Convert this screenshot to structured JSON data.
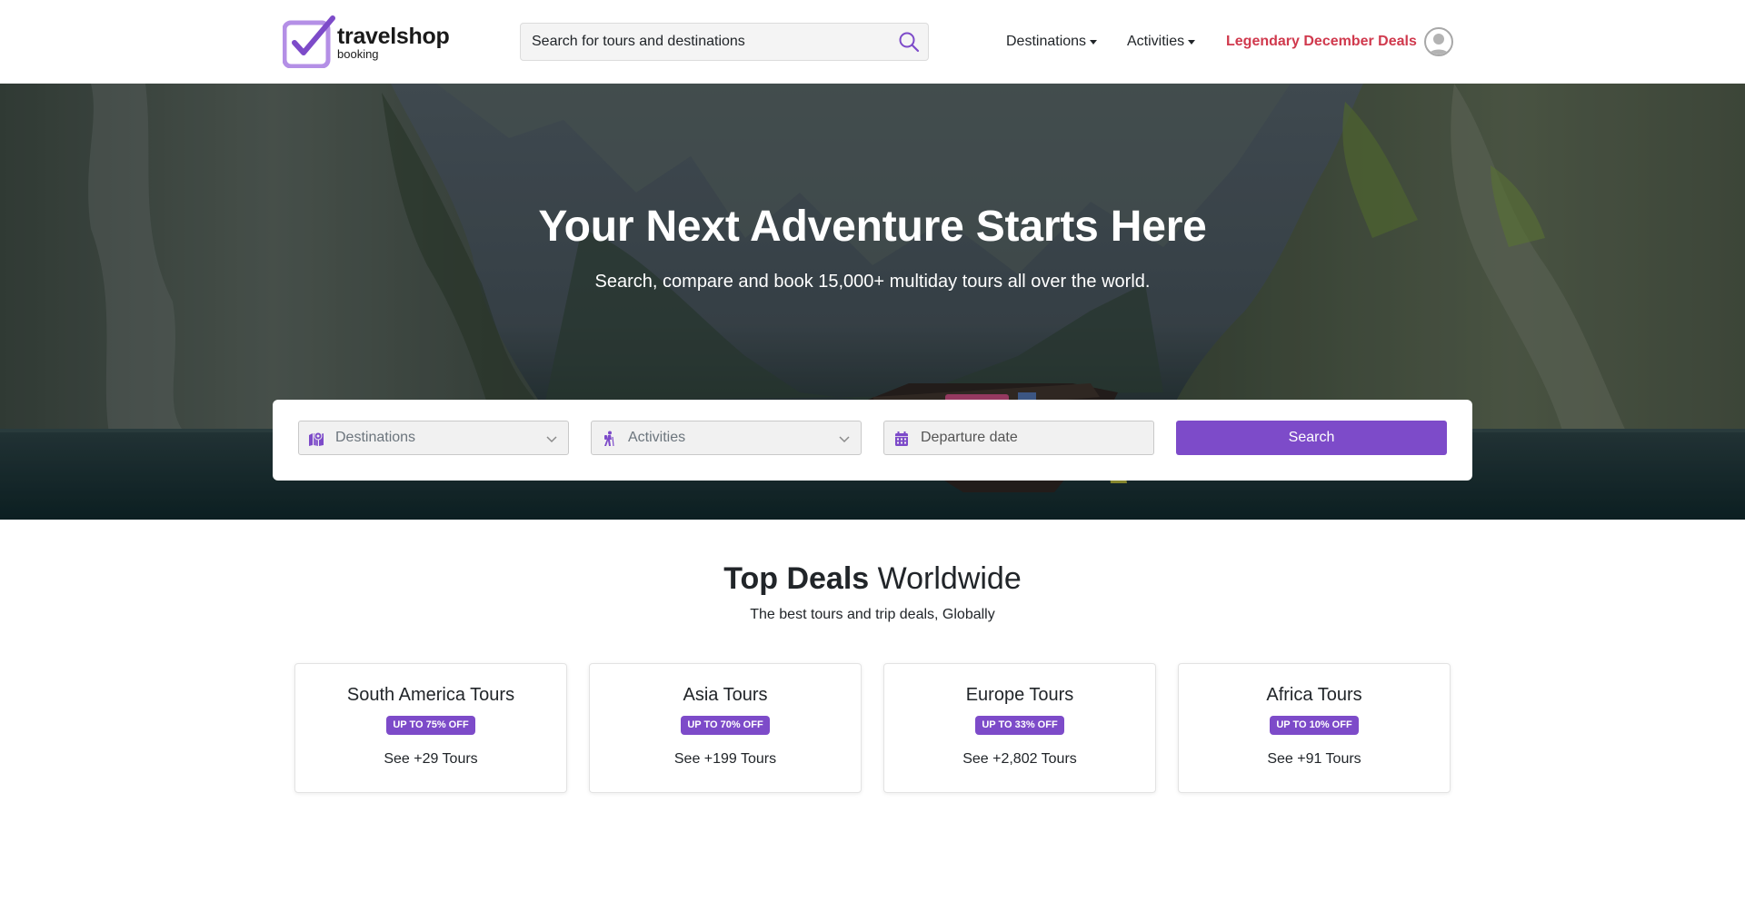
{
  "brand": {
    "name": "travelshop",
    "sub": "booking",
    "accent": "#7d4bc9",
    "accent_light": "#b48fe6"
  },
  "header": {
    "search_placeholder": "Search for tours and destinations",
    "nav": {
      "destinations": "Destinations",
      "activities": "Activities",
      "deals": "Legendary December Deals"
    },
    "deals_color": "#d0394d"
  },
  "hero": {
    "title": "Your Next Adventure Starts Here",
    "subtitle": "Search, compare and book 15,000+ multiday tours all over the world.",
    "search": {
      "destinations_label": "Destinations",
      "activities_label": "Activities",
      "date_placeholder": "Departure date",
      "button_label": "Search"
    }
  },
  "deals": {
    "heading_strong": "Top Deals",
    "heading_rest": " Worldwide",
    "subtitle": "The best tours and trip deals, Globally",
    "cards": [
      {
        "title": "South America Tours",
        "badge": "UP TO 75% OFF",
        "link": "See +29 Tours"
      },
      {
        "title": "Asia Tours",
        "badge": "UP TO 70% OFF",
        "link": "See +199 Tours"
      },
      {
        "title": "Europe Tours",
        "badge": "UP TO 33% OFF",
        "link": "See +2,802 Tours"
      },
      {
        "title": "Africa Tours",
        "badge": "UP TO 10% OFF",
        "link": "See +91 Tours"
      }
    ]
  }
}
